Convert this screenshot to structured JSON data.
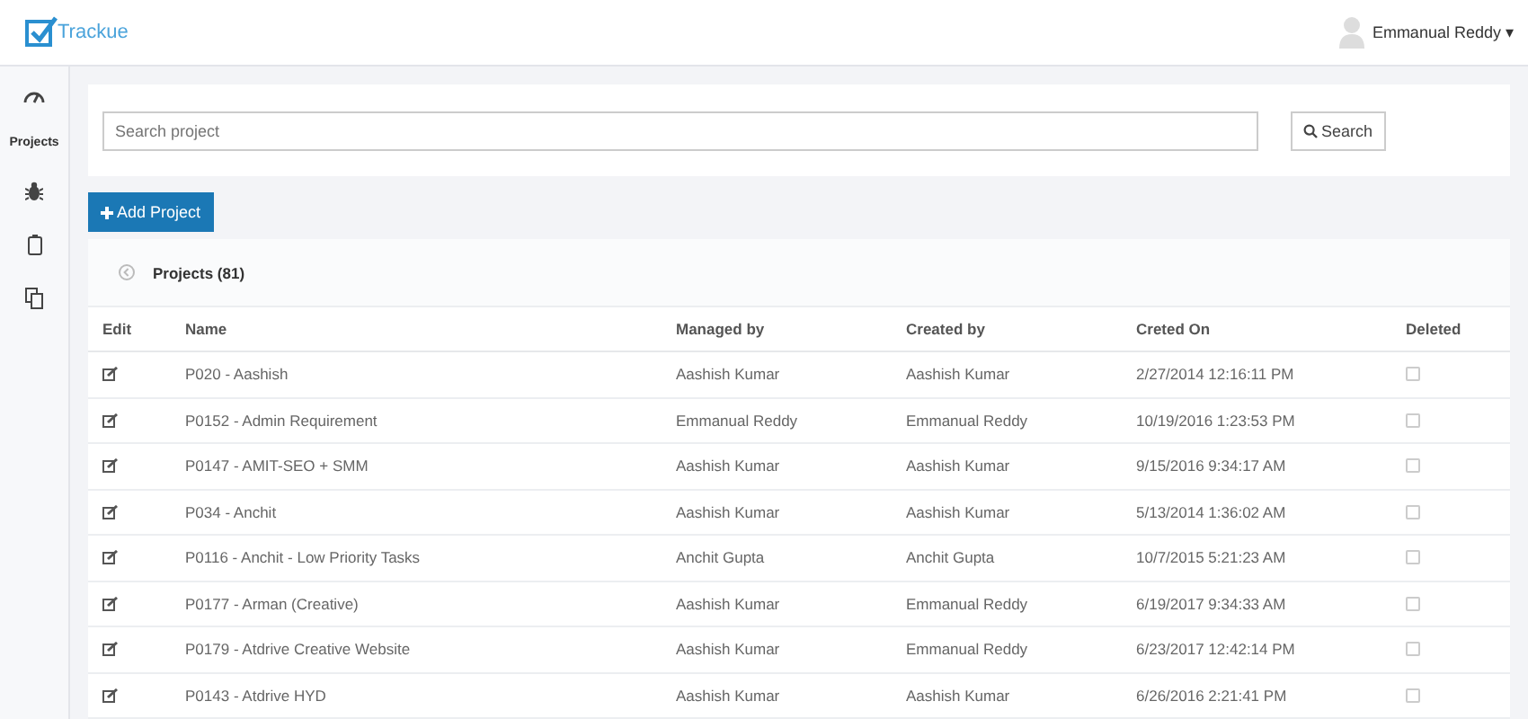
{
  "header": {
    "logo": "Trackue",
    "user": "Emmanual Reddy",
    "caret": "▾"
  },
  "sidebar": {
    "items": [
      {
        "kind": "gauge",
        "selected": false
      },
      {
        "kind": "label",
        "label": "Projects",
        "selected": true
      },
      {
        "kind": "bug",
        "selected": false
      },
      {
        "kind": "clipboard",
        "selected": false
      },
      {
        "kind": "copy",
        "selected": false
      }
    ]
  },
  "search": {
    "placeholder": "Search project",
    "button": "Search"
  },
  "add_button": "Add Project",
  "panel": {
    "title": "Projects (81)"
  },
  "table": {
    "columns": [
      "Edit",
      "Name",
      "Managed by",
      "Created by",
      "Creted On",
      "Deleted"
    ],
    "rows": [
      {
        "name": "P020 - Aashish",
        "managed_by": "Aashish Kumar",
        "created_by": "Aashish Kumar",
        "created_on": "2/27/2014 12:16:11 PM",
        "deleted": false
      },
      {
        "name": "P0152 - Admin Requirement",
        "managed_by": "Emmanual Reddy",
        "created_by": "Emmanual Reddy",
        "created_on": "10/19/2016 1:23:53 PM",
        "deleted": false
      },
      {
        "name": "P0147 - AMIT-SEO + SMM",
        "managed_by": "Aashish Kumar",
        "created_by": "Aashish Kumar",
        "created_on": "9/15/2016 9:34:17 AM",
        "deleted": false
      },
      {
        "name": "P034 - Anchit",
        "managed_by": "Aashish Kumar",
        "created_by": "Aashish Kumar",
        "created_on": "5/13/2014 1:36:02 AM",
        "deleted": false
      },
      {
        "name": "P0116 - Anchit - Low Priority Tasks",
        "managed_by": "Anchit Gupta",
        "created_by": "Anchit Gupta",
        "created_on": "10/7/2015 5:21:23 AM",
        "deleted": false
      },
      {
        "name": "P0177 - Arman (Creative)",
        "managed_by": "Aashish Kumar",
        "created_by": "Emmanual Reddy",
        "created_on": "6/19/2017 9:34:33 AM",
        "deleted": false
      },
      {
        "name": "P0179 - Atdrive Creative Website",
        "managed_by": "Aashish Kumar",
        "created_by": "Emmanual Reddy",
        "created_on": "6/23/2017 12:42:14 PM",
        "deleted": false
      },
      {
        "name": "P0143 - Atdrive HYD",
        "managed_by": "Aashish Kumar",
        "created_by": "Aashish Kumar",
        "created_on": "6/26/2016 2:21:41 PM",
        "deleted": false
      }
    ]
  }
}
